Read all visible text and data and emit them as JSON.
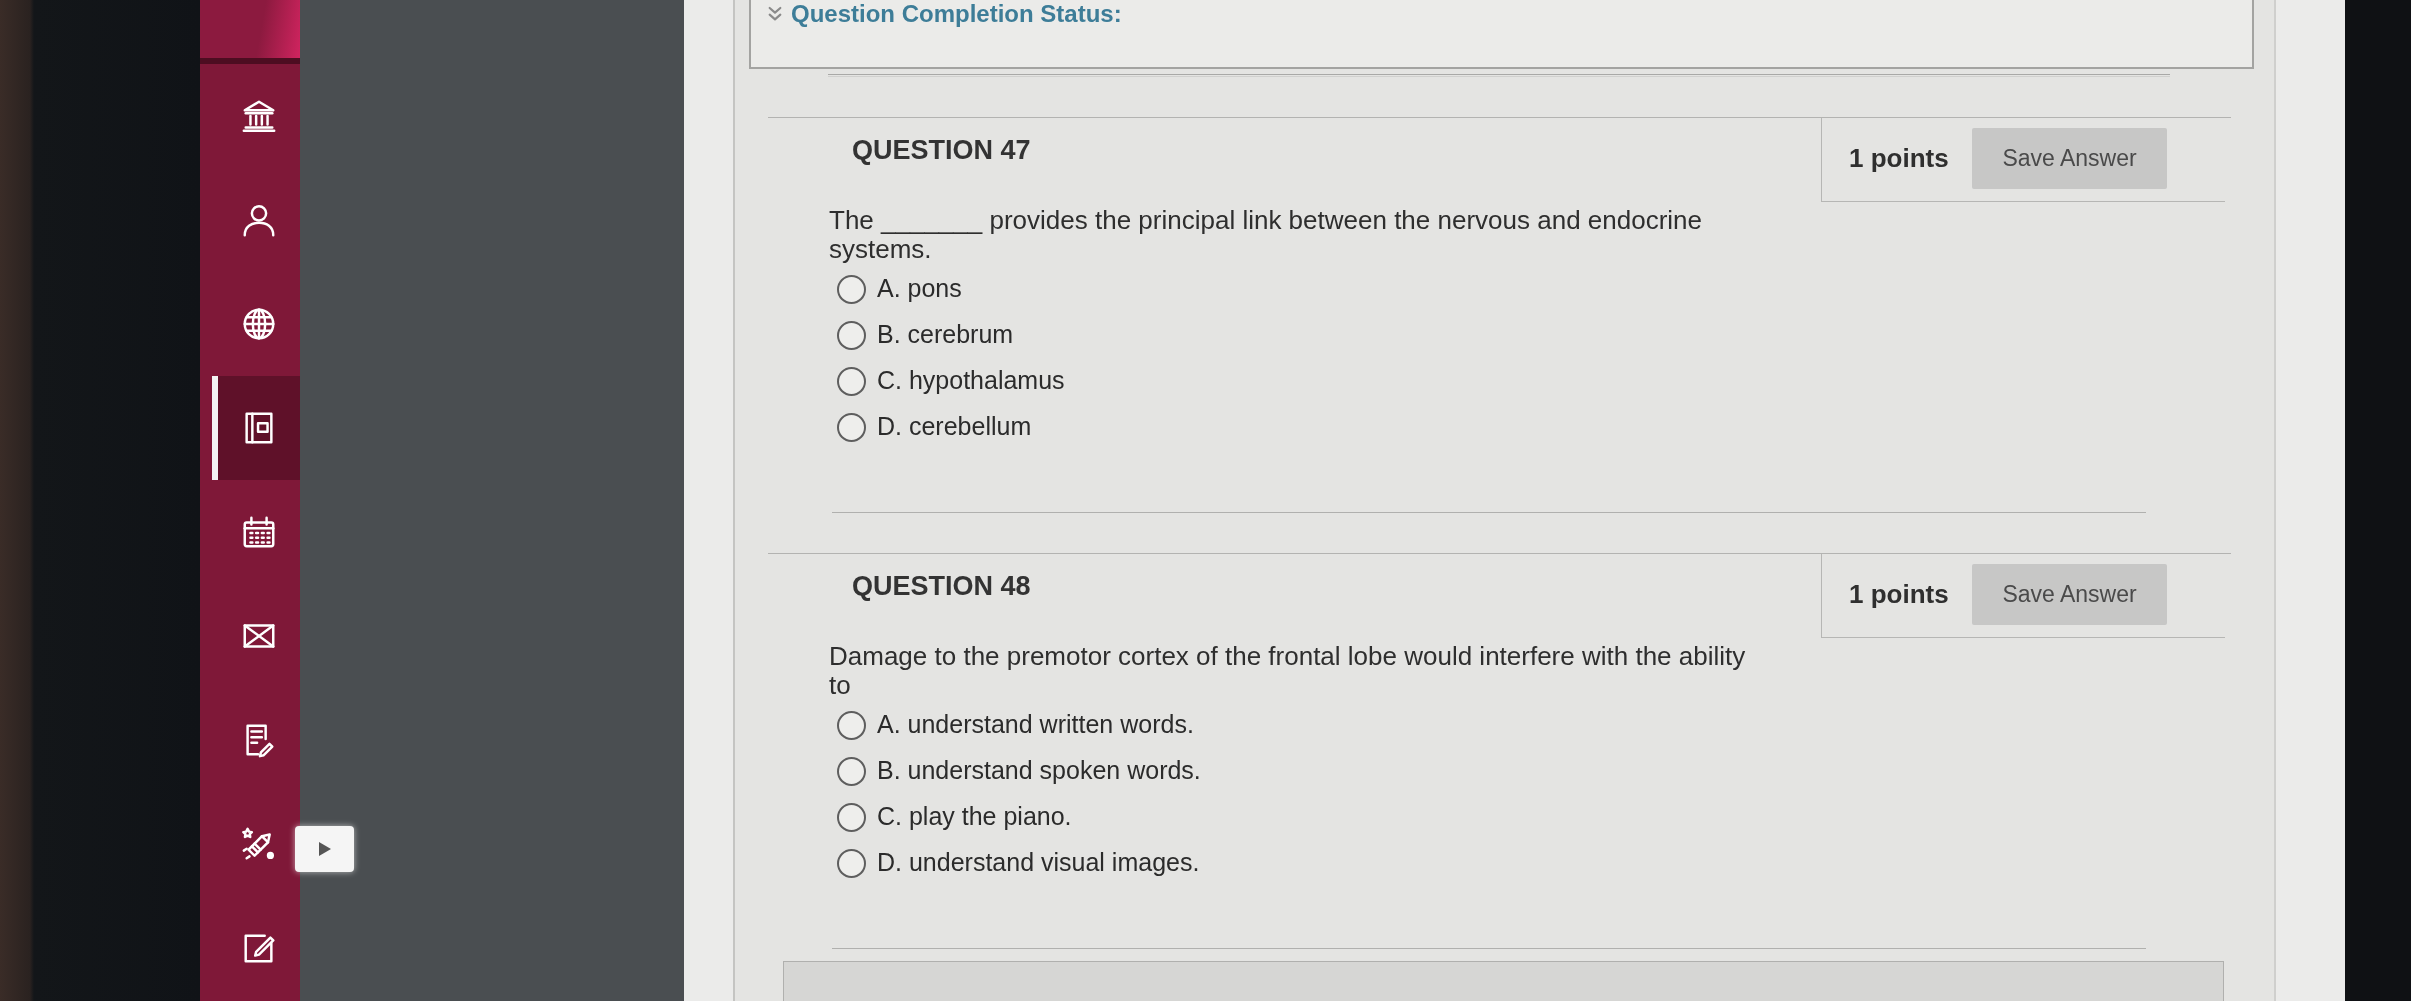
{
  "sidebar": {
    "items": [
      {
        "selected": false
      },
      {
        "selected": false
      },
      {
        "selected": false
      },
      {
        "selected": true
      },
      {
        "selected": false
      },
      {
        "selected": false
      },
      {
        "selected": false
      },
      {
        "selected": false
      },
      {
        "selected": false
      }
    ]
  },
  "completion_status": {
    "label": "Question Completion Status:"
  },
  "questions": [
    {
      "title": "QUESTION 47",
      "points": "1 points",
      "save_button": "Save Answer",
      "prompt": "The _______ provides the principal link between the nervous and endocrine systems.",
      "options": [
        {
          "text": "A. pons",
          "selected": false
        },
        {
          "text": "B. cerebrum",
          "selected": false
        },
        {
          "text": "C. hypothalamus",
          "selected": false
        },
        {
          "text": "D. cerebellum",
          "selected": false
        }
      ]
    },
    {
      "title": "QUESTION 48",
      "points": "1 points",
      "save_button": "Save Answer",
      "prompt": "Damage to the premotor cortex of the frontal lobe would interfere with the ability to",
      "options": [
        {
          "text": "A. understand written words.",
          "selected": false
        },
        {
          "text": "B. understand spoken words.",
          "selected": false
        },
        {
          "text": "C. play the piano.",
          "selected": false
        },
        {
          "text": "D. understand visual images.",
          "selected": false
        }
      ]
    }
  ]
}
